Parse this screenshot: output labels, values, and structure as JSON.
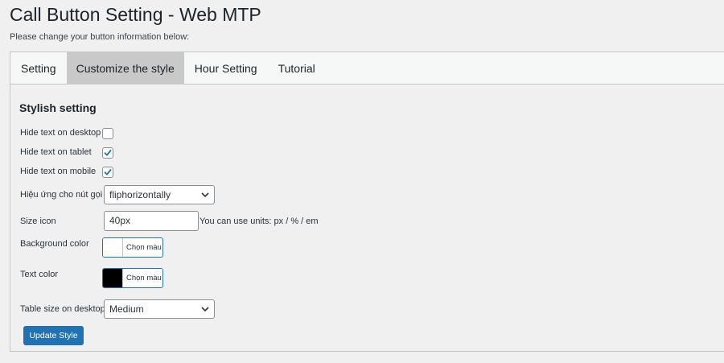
{
  "header": {
    "title": "Call Button Setting - Web MTP",
    "subtitle": "Please change your button information below:"
  },
  "tabs": [
    {
      "label": "Setting",
      "active": false
    },
    {
      "label": "Customize the style",
      "active": true
    },
    {
      "label": "Hour Setting",
      "active": false
    },
    {
      "label": "Tutorial",
      "active": false
    }
  ],
  "section": {
    "title": "Stylish setting"
  },
  "fields": {
    "hide_desktop": {
      "label": "Hide text on desktop",
      "checked": false
    },
    "hide_tablet": {
      "label": "Hide text on tablet",
      "checked": true
    },
    "hide_mobile": {
      "label": "Hide text on mobile",
      "checked": true
    },
    "effect": {
      "label": "Hiệu ứng cho nút gọi",
      "value": "fliphorizontally"
    },
    "size_icon": {
      "label": "Size icon",
      "value": "40px",
      "hint": "You can use units: px / % / em"
    },
    "background_color": {
      "label": "Background color",
      "button": "Chọn màu",
      "color": "#ffffff"
    },
    "text_color": {
      "label": "Text color",
      "button": "Chọn màu",
      "color": "#000000"
    },
    "table_size": {
      "label": "Table size on desktop",
      "value": "Medium"
    }
  },
  "actions": {
    "update_label": "Update Style"
  },
  "colors": {
    "accent": "#2271b1",
    "active_tab": "#c9c9c9",
    "background": "#f0f0f1"
  }
}
